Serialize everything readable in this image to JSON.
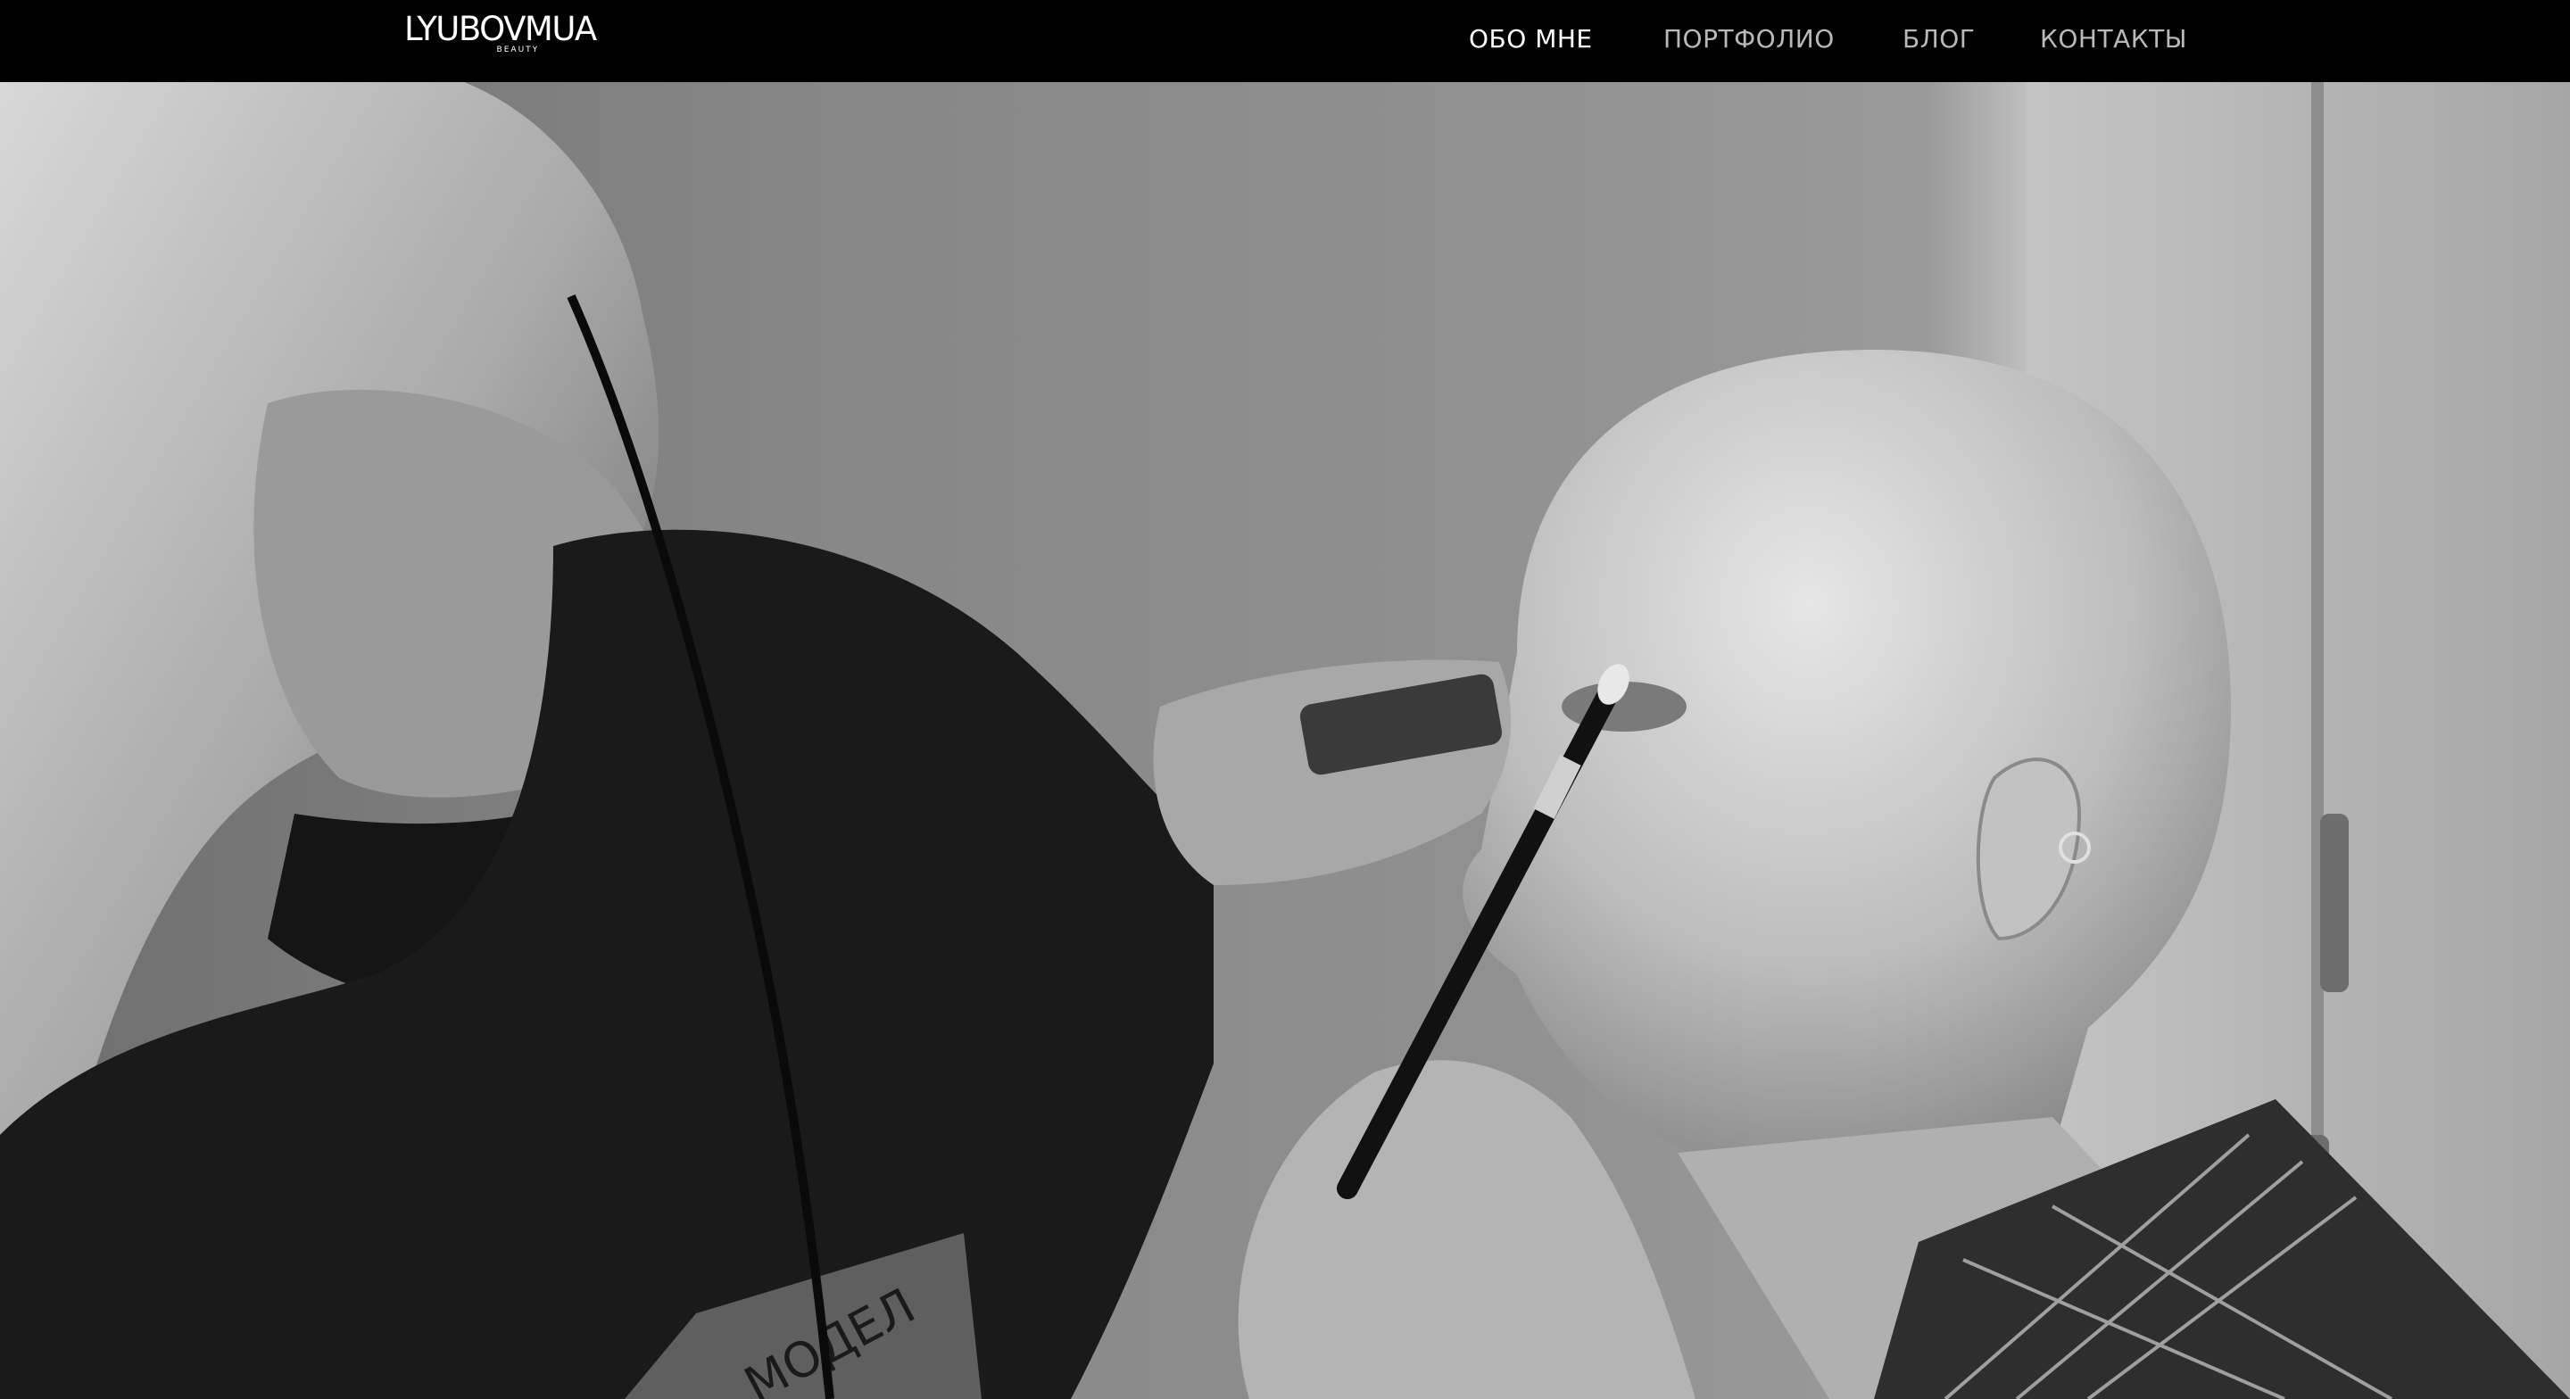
{
  "header": {
    "logo_text": "LYUBOVMUA",
    "logo_subtext": "BEAUTY",
    "nav": [
      {
        "label": "ОБО МНЕ",
        "active": true
      },
      {
        "label": "ПОРТФОЛИО",
        "active": false
      },
      {
        "label": "БЛОГ",
        "active": false
      },
      {
        "label": "КОНТАКТЫ",
        "active": false
      }
    ]
  },
  "hero": {
    "photo_subject": "makeup-artist-applying-eyeshadow",
    "shirt_print": "МОДЕЛ",
    "colors": {
      "background": "#000000",
      "nav_active": "#ffffff",
      "nav_inactive": "#b9b9b9"
    }
  }
}
